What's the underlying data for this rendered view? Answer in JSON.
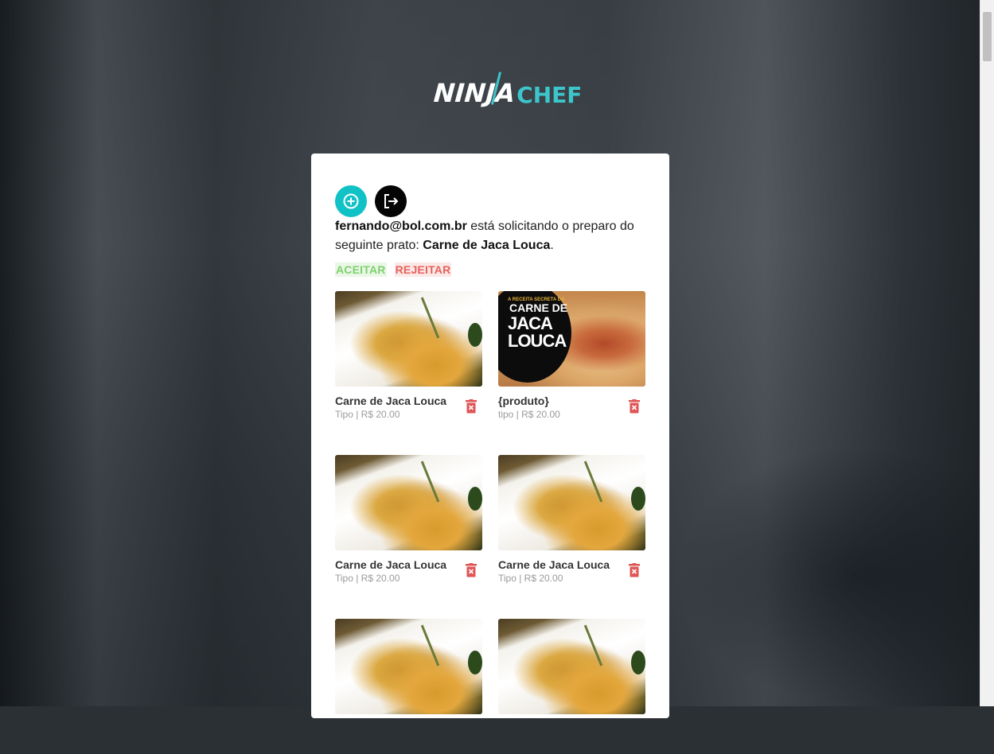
{
  "app": {
    "logo_primary": "NINJA",
    "logo_secondary": "CHEF"
  },
  "colors": {
    "accent": "#10c2c6",
    "accept": "#7dd06d",
    "reject": "#e8605a",
    "delete": "#e05555"
  },
  "toolbar": {
    "add_icon": "plus-circle-icon",
    "logout_icon": "logout-icon"
  },
  "request": {
    "email": "fernando@bol.com.br",
    "text": " está solicitando o preparo do seguinte prato: ",
    "dish": "Carne de Jaca Louca",
    "end": "."
  },
  "actions": {
    "accept_label": "ACEITAR",
    "reject_label": "REJEITAR"
  },
  "products": [
    {
      "name": "Carne de Jaca Louca",
      "meta": "Tipo | R$ 20.00",
      "image": "food"
    },
    {
      "name": "{produto}",
      "meta": "tipo | R$ 20.00",
      "image": "promo"
    },
    {
      "name": "Carne de Jaca Louca",
      "meta": "Tipo | R$ 20.00",
      "image": "food"
    },
    {
      "name": "Carne de Jaca Louca",
      "meta": "Tipo | R$ 20.00",
      "image": "food"
    },
    {
      "name": "",
      "meta": "",
      "image": "food"
    },
    {
      "name": "",
      "meta": "",
      "image": "food"
    }
  ],
  "promo_image": {
    "line1": "A RECEITA SECRETA DA",
    "line2": "CARNE DE",
    "line3": "JACA LOUCA"
  }
}
